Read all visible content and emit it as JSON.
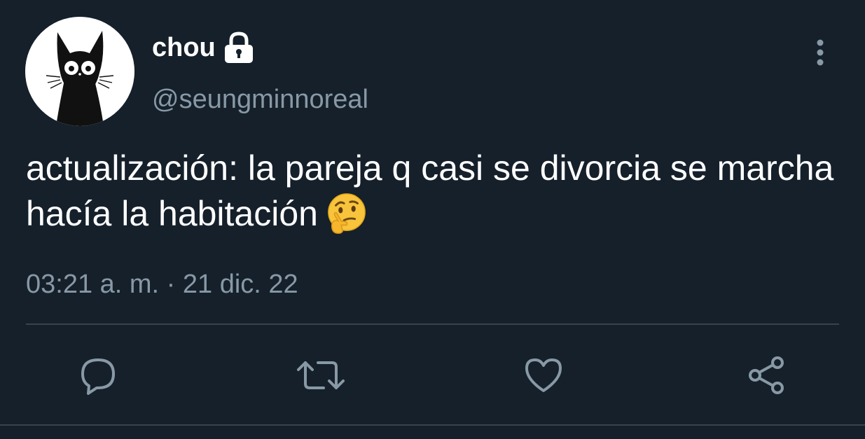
{
  "user": {
    "display_name": "chou",
    "handle": "@seungminnoreal",
    "protected": true,
    "avatar_icon": "black-cat-icon"
  },
  "tweet": {
    "text": "actualización: la pareja q casi se divorcia se marcha hacía la habitación",
    "emoji": "thinking-face-icon",
    "timestamp": "03:21 a. m. · 21 dic. 22"
  },
  "actions": [
    {
      "name": "reply",
      "icon": "reply-bubble-icon"
    },
    {
      "name": "retweet",
      "icon": "retweet-icon"
    },
    {
      "name": "like",
      "icon": "heart-icon"
    },
    {
      "name": "share",
      "icon": "share-icon"
    }
  ],
  "colors": {
    "background": "#15202b",
    "primary_text": "#ffffff",
    "secondary_text": "#8899a6",
    "divider": "#38444d"
  }
}
